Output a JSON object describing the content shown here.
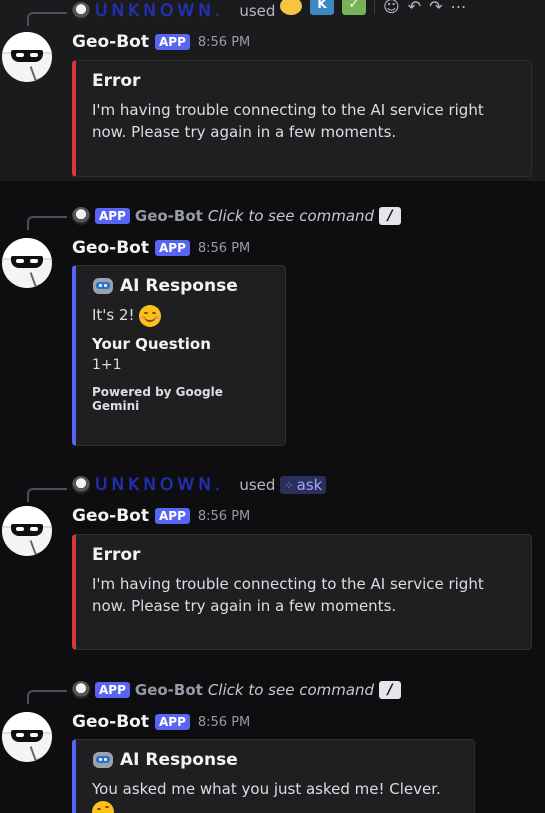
{
  "colors": {
    "background": "#0e0e10",
    "highlight": "#1b1b1e",
    "app_badge": "#5865f2",
    "error_bar": "#da373c",
    "embed_bar": "#5865f2",
    "unknown_user": "#1f2fbf"
  },
  "toolbar": {
    "icons": [
      "laugh-emoji-icon",
      "k-emoji-icon",
      "check-emoji-icon",
      "add-reaction-icon",
      "reply-icon",
      "forward-icon",
      "more-icon"
    ]
  },
  "messages": [
    {
      "ref": {
        "user": "UNKNOWN.",
        "used": "used",
        "command": ""
      },
      "author": "Geo-Bot",
      "badge": "APP",
      "time": "8:56 PM",
      "embed": {
        "title": "Error",
        "description": "I'm having trouble connecting to the AI service right now. Please try again in a few moments."
      }
    },
    {
      "ref": {
        "badge": "APP",
        "name": "Geo-Bot",
        "command": "Click to see command"
      },
      "author": "Geo-Bot",
      "badge": "APP",
      "time": "8:56 PM",
      "embed": {
        "title": "AI Response",
        "description": "It's 2!",
        "field_name": "Your Question",
        "field_value": "1+1",
        "footer": "Powered by Google Gemini"
      }
    },
    {
      "ref": {
        "user": "UNKNOWN.",
        "used": "used",
        "command": "ask"
      },
      "author": "Geo-Bot",
      "badge": "APP",
      "time": "8:56 PM",
      "embed": {
        "title": "Error",
        "description": "I'm having trouble connecting to the AI service right now. Please try again in a few moments."
      }
    },
    {
      "ref": {
        "badge": "APP",
        "name": "Geo-Bot",
        "command": "Click to see command"
      },
      "author": "Geo-Bot",
      "badge": "APP",
      "time": "8:56 PM",
      "embed": {
        "title": "AI Response",
        "description": "You asked me what you just asked me! Clever."
      }
    }
  ]
}
